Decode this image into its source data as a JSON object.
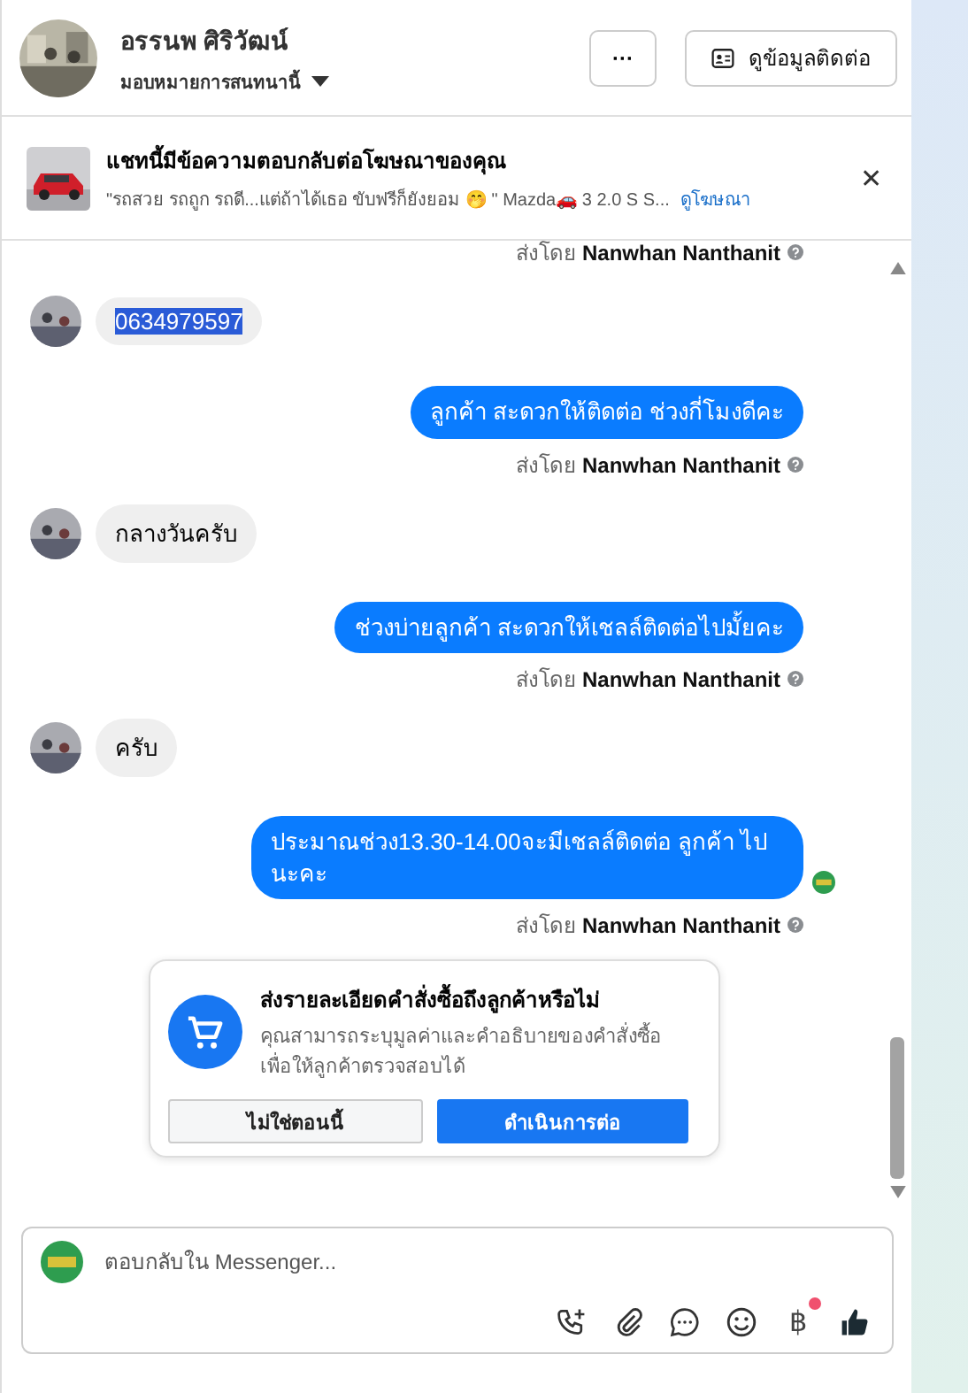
{
  "header": {
    "name": "อรรนพ ศิริวัฒน์",
    "assign_label": "มอบหมายการสนทนานี้",
    "more_button": "···",
    "contact_button": "ดูข้อมูลติดต่อ"
  },
  "ad_banner": {
    "title": "แชทนี้มีข้อความตอบกลับต่อโฆษณาของคุณ",
    "snippet": "\"รถสวย รถถูก รถดี...แต่ถ้าได้เธอ ขับฟรีก็ยังยอม 🤭 \" Mazda🚗 3 2.0 S S...",
    "link": "ดูโฆษณา",
    "close": "✕"
  },
  "messages": [
    {
      "kind": "sent_by",
      "label": "ส่งโดย",
      "sender": "Nanwhan Nanthanit"
    },
    {
      "kind": "incoming",
      "text": "0634979597",
      "highlighted": true
    },
    {
      "kind": "outgoing",
      "text": "ลูกค้า สะดวกให้ติดต่อ ช่วงกี่โมงดีคะ",
      "seen": false
    },
    {
      "kind": "sent_by",
      "label": "ส่งโดย",
      "sender": "Nanwhan Nanthanit"
    },
    {
      "kind": "incoming",
      "text": "กลางวันครับ",
      "highlighted": false
    },
    {
      "kind": "outgoing",
      "text": "ช่วงบ่ายลูกค้า สะดวกให้เชลล์ติดต่อไปมั้ยคะ",
      "seen": false
    },
    {
      "kind": "sent_by",
      "label": "ส่งโดย",
      "sender": "Nanwhan Nanthanit"
    },
    {
      "kind": "incoming",
      "text": "ครับ",
      "highlighted": false
    },
    {
      "kind": "outgoing",
      "text": "ประมาณช่วง13.30-14.00จะมีเชลล์ติดต่อ ลูกค้า ไปนะคะ",
      "seen": true
    },
    {
      "kind": "sent_by",
      "label": "ส่งโดย",
      "sender": "Nanwhan Nanthanit"
    }
  ],
  "order_prompt": {
    "title": "ส่งรายละเอียดคำสั่งซื้อถึงลูกค้าหรือไม่",
    "description": "คุณสามารถระบุมูลค่าและคำอธิบายของคำสั่งซื้อเพื่อให้ลูกค้าตรวจสอบได้",
    "secondary_button": "ไม่ใช่ตอนนี้",
    "primary_button": "ดำเนินการต่อ"
  },
  "composer": {
    "placeholder": "ตอบกลับใน Messenger...",
    "currency_symbol": "฿",
    "currency_badge": true
  }
}
